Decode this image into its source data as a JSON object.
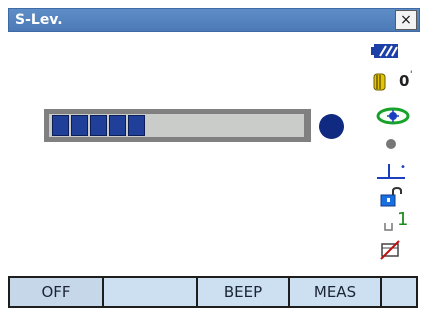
{
  "window": {
    "title": "S-Lev.",
    "close_label": "×"
  },
  "level": {
    "filled_segments": 5,
    "total_segments": 5
  },
  "status": {
    "battery": "battery-full",
    "prism_constant": "0",
    "prism_icon": "prism-icon",
    "laser_icon": "laser-plummet-icon",
    "target_icon": "target-dot-icon",
    "tilt_icon": "tilt-correction-icon",
    "lock_icon": "lock-icon",
    "input_mode_text": "1",
    "input_mode_icon": "input-mode-icon",
    "edit_icon": "edit-icon"
  },
  "softkeys": [
    "OFF",
    "",
    "BEEP",
    "MEAS",
    ""
  ],
  "colors": {
    "title_bg": "#5e8dc6",
    "softkey_bg": "#cde0f1",
    "bubble": "#0f2a80",
    "segment": "#1f3f99"
  }
}
